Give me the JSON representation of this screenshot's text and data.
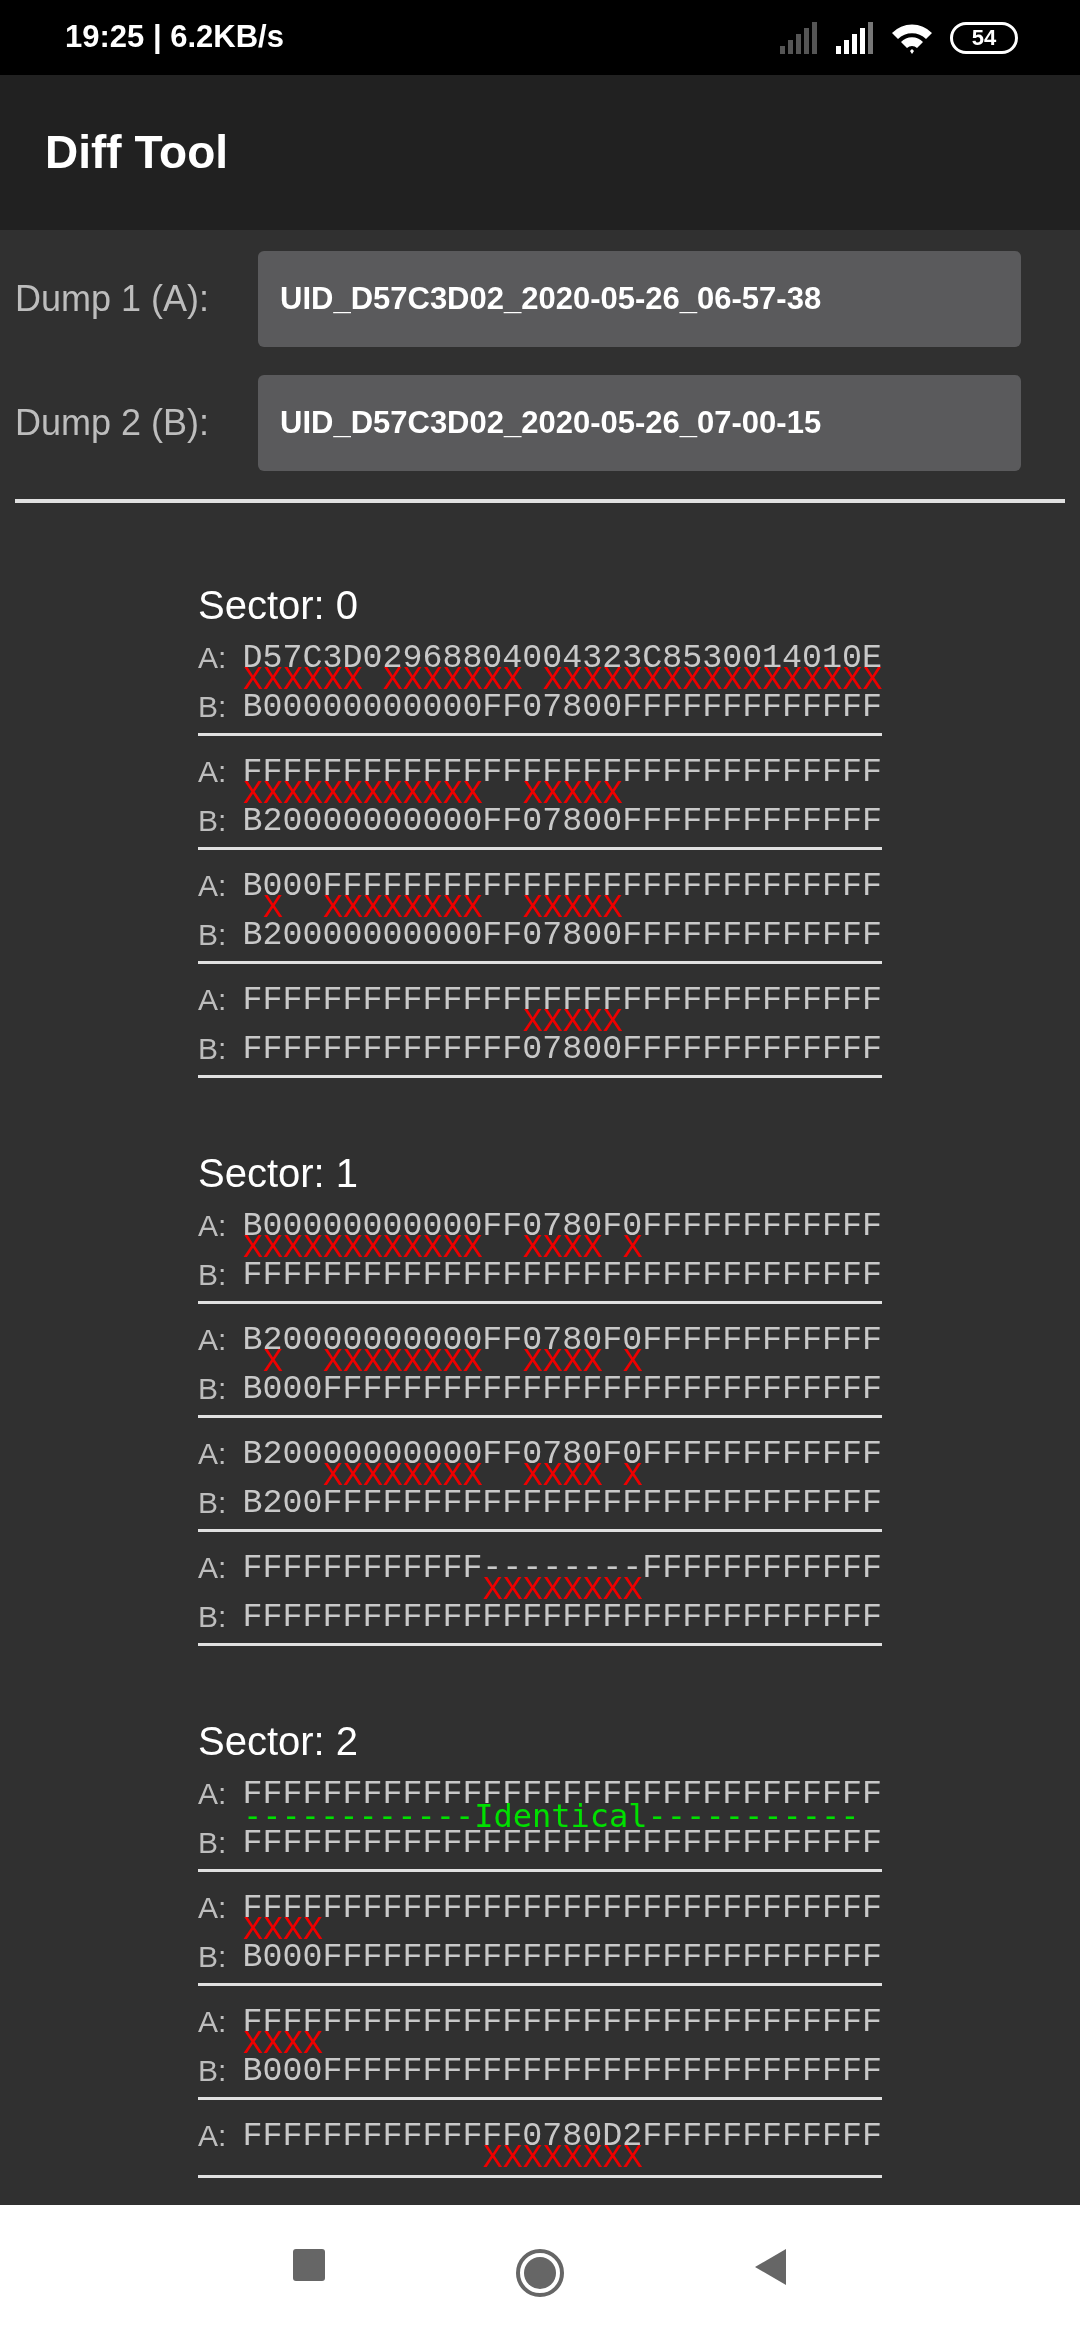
{
  "status_bar": {
    "time": "19:25 | 6.2KB/s",
    "battery": "54"
  },
  "app_bar": {
    "title": "Diff Tool"
  },
  "dumps": [
    {
      "label": "Dump 1 (A):",
      "value": "UID_D57C3D02_2020-05-26_06-57-38"
    },
    {
      "label": "Dump 2 (B):",
      "value": "UID_D57C3D02_2020-05-26_07-00-15"
    }
  ],
  "sectors": [
    {
      "title": "Sector: 0",
      "blocks": [
        {
          "a_label": "A:",
          "a": "D57C3D02968804004323C8530014010E",
          "kind": "diff",
          "marks": "XXXXXX XXXXXXX XXXXXXXXXXXXXXXXX",
          "b_label": "B:",
          "b": "B00000000000FF07800FFFFFFFFFFFFF"
        },
        {
          "a_label": "A:",
          "a": "FFFFFFFFFFFFFFFFFFFFFFFFFFFFFFFF",
          "kind": "diff",
          "marks": "XXXXXXXXXXXX  XXXXX",
          "b_label": "B:",
          "b": "B20000000000FF07800FFFFFFFFFFFFF"
        },
        {
          "a_label": "A:",
          "a": "B000FFFFFFFFFFFFFFFFFFFFFFFFFFFF",
          "kind": "diff",
          "marks": " X  XXXXXXXX  XXXXX",
          "b_label": "B:",
          "b": "B20000000000FF07800FFFFFFFFFFFFF"
        },
        {
          "a_label": "A:",
          "a": "FFFFFFFFFFFFFFFFFFFFFFFFFFFFFFFF",
          "kind": "diff",
          "marks": "              XXXXX",
          "b_label": "B:",
          "b": "FFFFFFFFFFFFFF07800FFFFFFFFFFFFF"
        }
      ]
    },
    {
      "title": "Sector: 1",
      "blocks": [
        {
          "a_label": "A:",
          "a": "B00000000000FF0780F0FFFFFFFFFFFF",
          "kind": "diff",
          "marks": "XXXXXXXXXXXX  XXXX X",
          "b_label": "B:",
          "b": "FFFFFFFFFFFFFFFFFFFFFFFFFFFFFFFF"
        },
        {
          "a_label": "A:",
          "a": "B20000000000FF0780F0FFFFFFFFFFFF",
          "kind": "diff",
          "marks": " X  XXXXXXXX  XXXX X",
          "b_label": "B:",
          "b": "B000FFFFFFFFFFFFFFFFFFFFFFFFFFFF"
        },
        {
          "a_label": "A:",
          "a": "B20000000000FF0780F0FFFFFFFFFFFF",
          "kind": "diff",
          "marks": "    XXXXXXXX  XXXX X",
          "b_label": "B:",
          "b": "B200FFFFFFFFFFFFFFFFFFFFFFFFFFFF"
        },
        {
          "a_label": "A:",
          "a": "FFFFFFFFFFFF--------FFFFFFFFFFFF",
          "kind": "diff",
          "marks": "            XXXXXXXX",
          "b_label": "B:",
          "b": "FFFFFFFFFFFFFFFFFFFFFFFFFFFFFFFF"
        }
      ]
    },
    {
      "title": "Sector: 2",
      "blocks": [
        {
          "a_label": "A:",
          "a": "FFFFFFFFFFFFFFFFFFFFFFFFFFFFFFFF",
          "kind": "identical",
          "marks": "------------Identical-----------",
          "b_label": "B:",
          "b": "FFFFFFFFFFFFFFFFFFFFFFFFFFFFFFFF"
        },
        {
          "a_label": "A:",
          "a": "FFFFFFFFFFFFFFFFFFFFFFFFFFFFFFFF",
          "kind": "diff",
          "marks": "XXXX",
          "b_label": "B:",
          "b": "B000FFFFFFFFFFFFFFFFFFFFFFFFFFFF"
        },
        {
          "a_label": "A:",
          "a": "FFFFFFFFFFFFFFFFFFFFFFFFFFFFFFFF",
          "kind": "diff",
          "marks": "XXXX",
          "b_label": "B:",
          "b": "B000FFFFFFFFFFFFFFFFFFFFFFFFFFFF"
        },
        {
          "a_label": "A:",
          "a": "FFFFFFFFFFFFFF0780D2FFFFFFFFFFFF",
          "kind": "diff",
          "marks": "            XXXXXXXX"
        }
      ]
    }
  ]
}
